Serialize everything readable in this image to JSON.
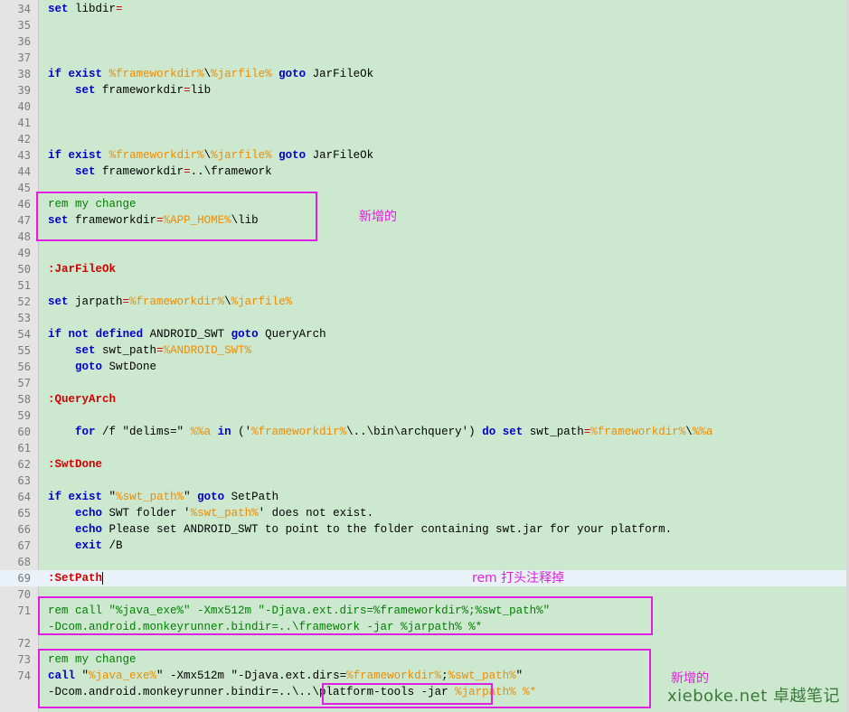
{
  "editor": {
    "lines": [
      {
        "n": "34",
        "tokens": [
          {
            "t": "set",
            "c": "kw"
          },
          {
            "t": " libdir",
            "c": "text"
          },
          {
            "t": "=",
            "c": "op"
          }
        ]
      },
      {
        "n": "35",
        "tokens": []
      },
      {
        "n": "36",
        "tokens": []
      },
      {
        "n": "37",
        "tokens": []
      },
      {
        "n": "38",
        "tokens": [
          {
            "t": "if",
            "c": "kw"
          },
          {
            "t": " ",
            "c": "text"
          },
          {
            "t": "exist",
            "c": "kw"
          },
          {
            "t": " ",
            "c": "text"
          },
          {
            "t": "%frameworkdir%",
            "c": "var"
          },
          {
            "t": "\\",
            "c": "text"
          },
          {
            "t": "%jarfile%",
            "c": "var"
          },
          {
            "t": " ",
            "c": "text"
          },
          {
            "t": "goto",
            "c": "kw"
          },
          {
            "t": " JarFileOk",
            "c": "text"
          }
        ]
      },
      {
        "n": "39",
        "tokens": [
          {
            "t": "    ",
            "c": "text"
          },
          {
            "t": "set",
            "c": "kw"
          },
          {
            "t": " frameworkdir",
            "c": "text"
          },
          {
            "t": "=",
            "c": "op"
          },
          {
            "t": "lib",
            "c": "text"
          }
        ]
      },
      {
        "n": "40",
        "tokens": []
      },
      {
        "n": "41",
        "tokens": []
      },
      {
        "n": "42",
        "tokens": []
      },
      {
        "n": "43",
        "tokens": [
          {
            "t": "if",
            "c": "kw"
          },
          {
            "t": " ",
            "c": "text"
          },
          {
            "t": "exist",
            "c": "kw"
          },
          {
            "t": " ",
            "c": "text"
          },
          {
            "t": "%frameworkdir%",
            "c": "var"
          },
          {
            "t": "\\",
            "c": "text"
          },
          {
            "t": "%jarfile%",
            "c": "var"
          },
          {
            "t": " ",
            "c": "text"
          },
          {
            "t": "goto",
            "c": "kw"
          },
          {
            "t": " JarFileOk",
            "c": "text"
          }
        ]
      },
      {
        "n": "44",
        "tokens": [
          {
            "t": "    ",
            "c": "text"
          },
          {
            "t": "set",
            "c": "kw"
          },
          {
            "t": " frameworkdir",
            "c": "text"
          },
          {
            "t": "=",
            "c": "op"
          },
          {
            "t": "..\\framework",
            "c": "text"
          }
        ]
      },
      {
        "n": "45",
        "tokens": []
      },
      {
        "n": "46",
        "tokens": [
          {
            "t": "rem my change",
            "c": "rem"
          }
        ]
      },
      {
        "n": "47",
        "tokens": [
          {
            "t": "set",
            "c": "kw"
          },
          {
            "t": " frameworkdir",
            "c": "text"
          },
          {
            "t": "=",
            "c": "op"
          },
          {
            "t": "%APP_HOME%",
            "c": "var"
          },
          {
            "t": "\\lib",
            "c": "text"
          }
        ]
      },
      {
        "n": "48",
        "tokens": []
      },
      {
        "n": "49",
        "tokens": []
      },
      {
        "n": "50",
        "tokens": [
          {
            "t": ":JarFileOk",
            "c": "label"
          }
        ]
      },
      {
        "n": "51",
        "tokens": []
      },
      {
        "n": "52",
        "tokens": [
          {
            "t": "set",
            "c": "kw"
          },
          {
            "t": " jarpath",
            "c": "text"
          },
          {
            "t": "=",
            "c": "op"
          },
          {
            "t": "%frameworkdir%",
            "c": "var"
          },
          {
            "t": "\\",
            "c": "text"
          },
          {
            "t": "%jarfile%",
            "c": "var"
          }
        ]
      },
      {
        "n": "53",
        "tokens": []
      },
      {
        "n": "54",
        "tokens": [
          {
            "t": "if",
            "c": "kw"
          },
          {
            "t": " ",
            "c": "text"
          },
          {
            "t": "not",
            "c": "kw"
          },
          {
            "t": " ",
            "c": "text"
          },
          {
            "t": "defined",
            "c": "kw"
          },
          {
            "t": " ANDROID_SWT ",
            "c": "text"
          },
          {
            "t": "goto",
            "c": "kw"
          },
          {
            "t": " QueryArch",
            "c": "text"
          }
        ]
      },
      {
        "n": "55",
        "tokens": [
          {
            "t": "    ",
            "c": "text"
          },
          {
            "t": "set",
            "c": "kw"
          },
          {
            "t": " swt_path",
            "c": "text"
          },
          {
            "t": "=",
            "c": "op"
          },
          {
            "t": "%ANDROID_SWT%",
            "c": "var"
          }
        ]
      },
      {
        "n": "56",
        "tokens": [
          {
            "t": "    ",
            "c": "text"
          },
          {
            "t": "goto",
            "c": "kw"
          },
          {
            "t": " SwtDone",
            "c": "text"
          }
        ]
      },
      {
        "n": "57",
        "tokens": []
      },
      {
        "n": "58",
        "tokens": [
          {
            "t": ":QueryArch",
            "c": "label"
          }
        ]
      },
      {
        "n": "59",
        "tokens": []
      },
      {
        "n": "60",
        "tokens": [
          {
            "t": "    ",
            "c": "text"
          },
          {
            "t": "for",
            "c": "kw"
          },
          {
            "t": " /f \"delims=\" ",
            "c": "text"
          },
          {
            "t": "%%a",
            "c": "var"
          },
          {
            "t": " ",
            "c": "text"
          },
          {
            "t": "in",
            "c": "kw"
          },
          {
            "t": " ('",
            "c": "text"
          },
          {
            "t": "%frameworkdir%",
            "c": "var"
          },
          {
            "t": "\\..\\bin\\archquery') ",
            "c": "text"
          },
          {
            "t": "do",
            "c": "kw"
          },
          {
            "t": " ",
            "c": "text"
          },
          {
            "t": "set",
            "c": "kw"
          },
          {
            "t": " swt_path",
            "c": "text"
          },
          {
            "t": "=",
            "c": "op"
          },
          {
            "t": "%frameworkdir%",
            "c": "var"
          },
          {
            "t": "\\",
            "c": "text"
          },
          {
            "t": "%%a",
            "c": "var"
          }
        ]
      },
      {
        "n": "61",
        "tokens": []
      },
      {
        "n": "62",
        "tokens": [
          {
            "t": ":SwtDone",
            "c": "label"
          }
        ]
      },
      {
        "n": "63",
        "tokens": []
      },
      {
        "n": "64",
        "tokens": [
          {
            "t": "if",
            "c": "kw"
          },
          {
            "t": " ",
            "c": "text"
          },
          {
            "t": "exist",
            "c": "kw"
          },
          {
            "t": " \"",
            "c": "text"
          },
          {
            "t": "%swt_path%",
            "c": "var"
          },
          {
            "t": "\" ",
            "c": "text"
          },
          {
            "t": "goto",
            "c": "kw"
          },
          {
            "t": " SetPath",
            "c": "text"
          }
        ]
      },
      {
        "n": "65",
        "tokens": [
          {
            "t": "    ",
            "c": "text"
          },
          {
            "t": "echo",
            "c": "kw"
          },
          {
            "t": " SWT folder '",
            "c": "text"
          },
          {
            "t": "%swt_path%",
            "c": "var"
          },
          {
            "t": "' does not exist.",
            "c": "text"
          }
        ]
      },
      {
        "n": "66",
        "tokens": [
          {
            "t": "    ",
            "c": "text"
          },
          {
            "t": "echo",
            "c": "kw"
          },
          {
            "t": " Please set ANDROID_SWT to point to the folder containing swt.jar for your platform.",
            "c": "text"
          }
        ]
      },
      {
        "n": "67",
        "tokens": [
          {
            "t": "    ",
            "c": "text"
          },
          {
            "t": "exit",
            "c": "kw"
          },
          {
            "t": " /B",
            "c": "text"
          }
        ]
      },
      {
        "n": "68",
        "tokens": []
      },
      {
        "n": "69",
        "tokens": [
          {
            "t": ":SetPath",
            "c": "label"
          }
        ],
        "current": true
      },
      {
        "n": "70",
        "tokens": []
      },
      {
        "n": "71",
        "tokens": [
          {
            "t": "rem call \"%java_exe%\" -Xmx512m \"-Djava.ext.dirs=%frameworkdir%;%swt_path%\"",
            "c": "rem"
          }
        ]
      },
      {
        "n": "",
        "tokens": [
          {
            "t": "-Dcom.android.monkeyrunner.bindir=..\\framework -jar %jarpath% %*",
            "c": "rem"
          }
        ]
      },
      {
        "n": "72",
        "tokens": []
      },
      {
        "n": "73",
        "tokens": [
          {
            "t": "rem my change",
            "c": "rem"
          }
        ]
      },
      {
        "n": "74",
        "tokens": [
          {
            "t": "call",
            "c": "kw"
          },
          {
            "t": " \"",
            "c": "text"
          },
          {
            "t": "%java_exe%",
            "c": "var"
          },
          {
            "t": "\" -Xmx512m \"-Djava.ext.dirs=",
            "c": "text"
          },
          {
            "t": "%frameworkdir%",
            "c": "var"
          },
          {
            "t": ";",
            "c": "text"
          },
          {
            "t": "%swt_path%",
            "c": "var"
          },
          {
            "t": "\"",
            "c": "text"
          }
        ]
      },
      {
        "n": "",
        "tokens": [
          {
            "t": "-Dcom.android.monkeyrunner.bindir=",
            "c": "text"
          },
          {
            "t": "..\\..\\platform-tools",
            "c": "text"
          },
          {
            "t": " -jar ",
            "c": "text"
          },
          {
            "t": "%jarpath%",
            "c": "var"
          },
          {
            "t": " ",
            "c": "text"
          },
          {
            "t": "%*",
            "c": "var"
          }
        ]
      }
    ]
  },
  "annotations": {
    "note_added_1": "新增的",
    "note_rem": "rem 打头注释掉",
    "note_added_2": "新增的"
  },
  "watermark": "xieboke.net 卓越笔记",
  "colors": {
    "background": "#cce8cf",
    "keyword": "#0000c8",
    "variable": "#f08c00",
    "label": "#d00000",
    "comment": "#008000",
    "annotation": "#e020e0"
  }
}
